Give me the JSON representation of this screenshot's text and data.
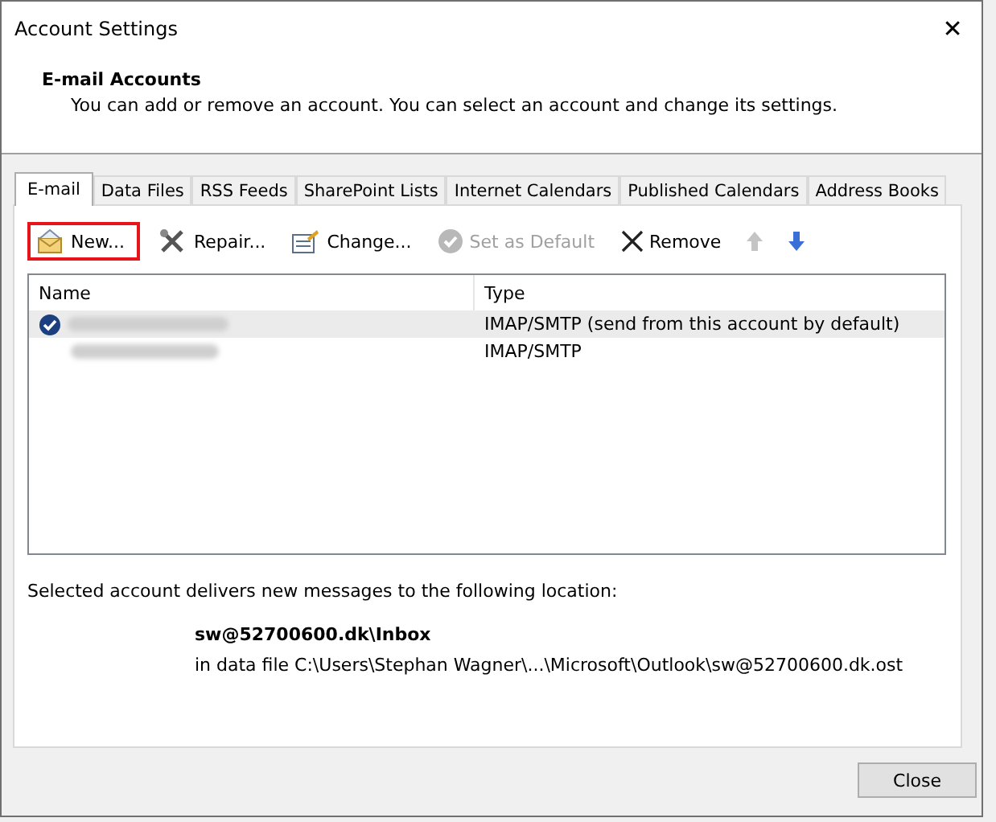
{
  "window": {
    "title": "Account Settings",
    "close": "✕"
  },
  "header": {
    "heading": "E-mail Accounts",
    "description": "You can add or remove an account. You can select an account and change its settings."
  },
  "tabs": [
    {
      "label": "E-mail",
      "selected": true
    },
    {
      "label": "Data Files",
      "selected": false
    },
    {
      "label": "RSS Feeds",
      "selected": false
    },
    {
      "label": "SharePoint Lists",
      "selected": false
    },
    {
      "label": "Internet Calendars",
      "selected": false
    },
    {
      "label": "Published Calendars",
      "selected": false
    },
    {
      "label": "Address Books",
      "selected": false
    }
  ],
  "toolbar": [
    {
      "kind": "new",
      "label": "New...",
      "disabled": false,
      "highlighted": true
    },
    {
      "kind": "repair",
      "label": "Repair...",
      "disabled": false,
      "highlighted": false
    },
    {
      "kind": "change",
      "label": "Change...",
      "disabled": false,
      "highlighted": false
    },
    {
      "kind": "default",
      "label": "Set as Default",
      "disabled": true,
      "highlighted": false
    },
    {
      "kind": "remove",
      "label": "Remove",
      "disabled": false,
      "highlighted": false
    },
    {
      "kind": "up",
      "disabled": true,
      "highlighted": false
    },
    {
      "kind": "down",
      "disabled": false,
      "highlighted": false
    }
  ],
  "table": {
    "columns": [
      "Name",
      "Type"
    ],
    "rows": [
      {
        "type": "IMAP/SMTP (send from this account by default)",
        "selected": true,
        "default": true
      },
      {
        "type": "IMAP/SMTP",
        "selected": false,
        "default": false
      }
    ]
  },
  "delivery": {
    "intro": "Selected account delivers new messages to the following location:",
    "folder": "sw@52700600.dk\\Inbox",
    "data_file": "in data file C:\\Users\\Stephan Wagner\\...\\Microsoft\\Outlook\\sw@52700600.dk.ost"
  },
  "buttons": [
    "Close"
  ]
}
